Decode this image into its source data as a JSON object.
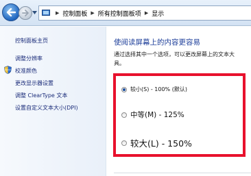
{
  "address_bar": {
    "crumbs": [
      "控制面板",
      "所有控制面板项",
      "显示"
    ]
  },
  "sidebar": {
    "items": [
      {
        "label": "控制面板主页"
      },
      {
        "label": "调整分辨率"
      },
      {
        "label": "校准颜色"
      },
      {
        "label": "更改显示器设置"
      },
      {
        "label": "调整 ClearType 文本"
      },
      {
        "label": "设置自定义文本大小(DPI)"
      }
    ]
  },
  "main": {
    "title": "使阅读屏幕上的内容更容易",
    "description_line1": "通过选择其中一个选项，可以更改屏幕上的文本大",
    "description_line2": "具。",
    "options": [
      {
        "label": "较小(S) - 100% (默认)",
        "selected": true
      },
      {
        "label": "中等(M) - 125%",
        "selected": false
      },
      {
        "label": "较大(L) - 150%",
        "selected": false
      }
    ]
  },
  "colors": {
    "highlight": "#e8112d",
    "link": "#1b2c7a",
    "title": "#1e3f9a"
  }
}
